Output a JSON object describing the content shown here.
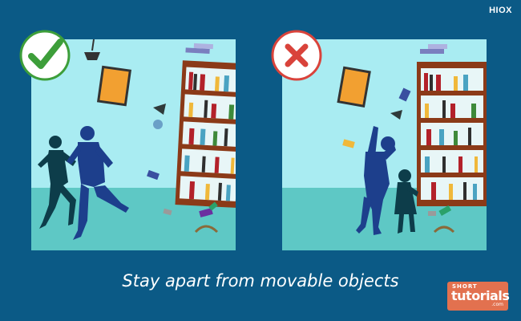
{
  "brand": {
    "label": "HIOX"
  },
  "caption": {
    "text": "Stay apart from movable objects"
  },
  "logo": {
    "line1": "SHORT",
    "line2": "tutorials",
    "line3": ".com"
  },
  "panels": [
    {
      "id": "correct",
      "status": "check-icon",
      "description_color": "#3d9e3a"
    },
    {
      "id": "incorrect",
      "status": "cross-icon",
      "description_color": "#d9433b"
    }
  ],
  "colors": {
    "background": "#0b5a86",
    "wall": "#a9ecf2",
    "floor": "#5ec8c5",
    "bookshelf": "#8b3a18",
    "silhouette_dark": "#0d3d4a",
    "silhouette_blue": "#1d3f8c"
  }
}
